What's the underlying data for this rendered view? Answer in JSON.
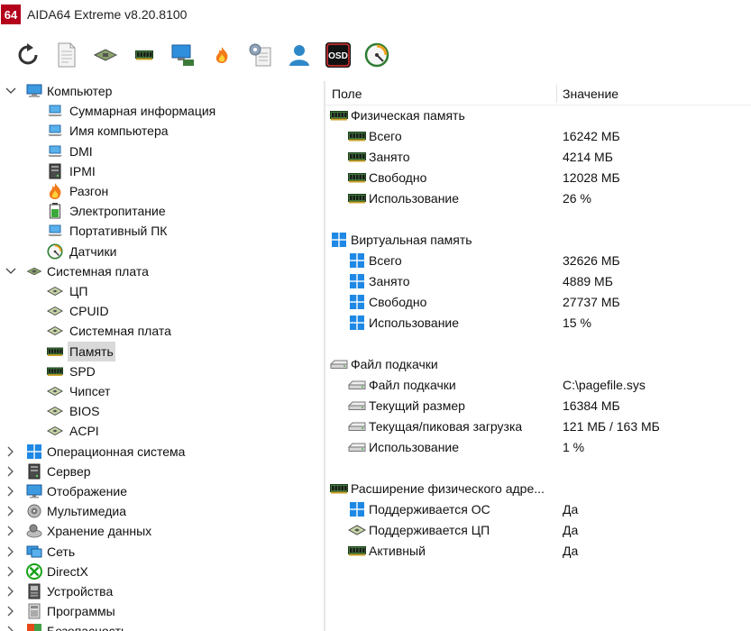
{
  "window": {
    "logo": "64",
    "title": "AIDA64 Extreme v8.20.8100"
  },
  "toolbar": {
    "buttons": [
      {
        "name": "refresh-icon"
      },
      {
        "name": "report-icon"
      },
      {
        "name": "motherboard-icon"
      },
      {
        "name": "memory-icon"
      },
      {
        "name": "network-computer-icon"
      },
      {
        "name": "flame-icon"
      },
      {
        "name": "tools-icon"
      },
      {
        "name": "user-icon"
      },
      {
        "name": "osd-icon",
        "text": "OSD"
      },
      {
        "name": "gauge-icon"
      }
    ]
  },
  "tree": {
    "items": [
      {
        "label": "Компьютер",
        "level": 0,
        "expander": "down",
        "icon": "computer-icon"
      },
      {
        "label": "Суммарная информация",
        "level": 1,
        "icon": "laptop-icon"
      },
      {
        "label": "Имя компьютера",
        "level": 1,
        "icon": "laptop-icon"
      },
      {
        "label": "DMI",
        "level": 1,
        "icon": "laptop-icon"
      },
      {
        "label": "IPMI",
        "level": 1,
        "icon": "server-icon"
      },
      {
        "label": "Разгон",
        "level": 1,
        "icon": "flame-icon"
      },
      {
        "label": "Электропитание",
        "level": 1,
        "icon": "battery-icon"
      },
      {
        "label": "Портативный ПК",
        "level": 1,
        "icon": "laptop-icon"
      },
      {
        "label": "Датчики",
        "level": 1,
        "icon": "gauge-icon"
      },
      {
        "label": "Системная плата",
        "level": 0,
        "expander": "down",
        "icon": "motherboard-icon"
      },
      {
        "label": "ЦП",
        "level": 1,
        "icon": "chip-icon"
      },
      {
        "label": "CPUID",
        "level": 1,
        "icon": "chip-icon"
      },
      {
        "label": "Системная плата",
        "level": 1,
        "icon": "chip-icon"
      },
      {
        "label": "Память",
        "level": 1,
        "icon": "memory-icon",
        "selected": true
      },
      {
        "label": "SPD",
        "level": 1,
        "icon": "memory-icon"
      },
      {
        "label": "Чипсет",
        "level": 1,
        "icon": "chip-icon"
      },
      {
        "label": "BIOS",
        "level": 1,
        "icon": "chip-icon"
      },
      {
        "label": "ACPI",
        "level": 1,
        "icon": "chip-icon"
      },
      {
        "label": "Операционная система",
        "level": 0,
        "expander": "right",
        "icon": "windows-icon"
      },
      {
        "label": "Сервер",
        "level": 0,
        "expander": "right",
        "icon": "server-icon"
      },
      {
        "label": "Отображение",
        "level": 0,
        "expander": "right",
        "icon": "monitor-icon"
      },
      {
        "label": "Мультимедиа",
        "level": 0,
        "expander": "right",
        "icon": "speaker-icon"
      },
      {
        "label": "Хранение данных",
        "level": 0,
        "expander": "right",
        "icon": "storage-icon"
      },
      {
        "label": "Сеть",
        "level": 0,
        "expander": "right",
        "icon": "network-icon"
      },
      {
        "label": "DirectX",
        "level": 0,
        "expander": "right",
        "icon": "xbox-icon"
      },
      {
        "label": "Устройства",
        "level": 0,
        "expander": "right",
        "icon": "devices-icon"
      },
      {
        "label": "Программы",
        "level": 0,
        "expander": "right",
        "icon": "programs-icon"
      },
      {
        "label": "Безопасность",
        "level": 0,
        "expander": "right",
        "icon": "security-icon"
      }
    ]
  },
  "listview": {
    "columns": {
      "field": "Поле",
      "value": "Значение"
    },
    "rows": [
      {
        "type": "group",
        "icon": "memory-icon",
        "field": "Физическая память",
        "value": ""
      },
      {
        "type": "item",
        "icon": "memory-icon",
        "field": "Всего",
        "value": "16242 МБ"
      },
      {
        "type": "item",
        "icon": "memory-icon",
        "field": "Занято",
        "value": "4214 МБ"
      },
      {
        "type": "item",
        "icon": "memory-icon",
        "field": "Свободно",
        "value": "12028 МБ"
      },
      {
        "type": "item",
        "icon": "memory-icon",
        "field": "Использование",
        "value": "26 %"
      },
      {
        "type": "blank"
      },
      {
        "type": "group",
        "icon": "windows-icon",
        "field": "Виртуальная память",
        "value": ""
      },
      {
        "type": "item",
        "icon": "windows-icon",
        "field": "Всего",
        "value": "32626 МБ"
      },
      {
        "type": "item",
        "icon": "windows-icon",
        "field": "Занято",
        "value": "4889 МБ"
      },
      {
        "type": "item",
        "icon": "windows-icon",
        "field": "Свободно",
        "value": "27737 МБ"
      },
      {
        "type": "item",
        "icon": "windows-icon",
        "field": "Использование",
        "value": "15 %"
      },
      {
        "type": "blank"
      },
      {
        "type": "group",
        "icon": "drive-icon",
        "field": "Файл подкачки",
        "value": ""
      },
      {
        "type": "item",
        "icon": "drive-icon",
        "field": "Файл подкачки",
        "value": "C:\\pagefile.sys"
      },
      {
        "type": "item",
        "icon": "drive-icon",
        "field": "Текущий размер",
        "value": "16384 МБ"
      },
      {
        "type": "item",
        "icon": "drive-icon",
        "field": "Текущая/пиковая загрузка",
        "value": "121 МБ / 163 МБ"
      },
      {
        "type": "item",
        "icon": "drive-icon",
        "field": "Использование",
        "value": "1 %"
      },
      {
        "type": "blank"
      },
      {
        "type": "group",
        "icon": "memory-icon",
        "field": "Расширение физического адре...",
        "value": ""
      },
      {
        "type": "item",
        "icon": "windows-icon",
        "field": "Поддерживается ОС",
        "value": "Да"
      },
      {
        "type": "item",
        "icon": "chip-icon",
        "field": "Поддерживается ЦП",
        "value": "Да"
      },
      {
        "type": "item",
        "icon": "memory-icon",
        "field": "Активный",
        "value": "Да"
      }
    ]
  },
  "colors": {
    "app_logo_bg": "#b3001b",
    "selection": "#d9d9d9",
    "windows_blue": "#1e88e5",
    "memory_green": "#2e7d32"
  }
}
